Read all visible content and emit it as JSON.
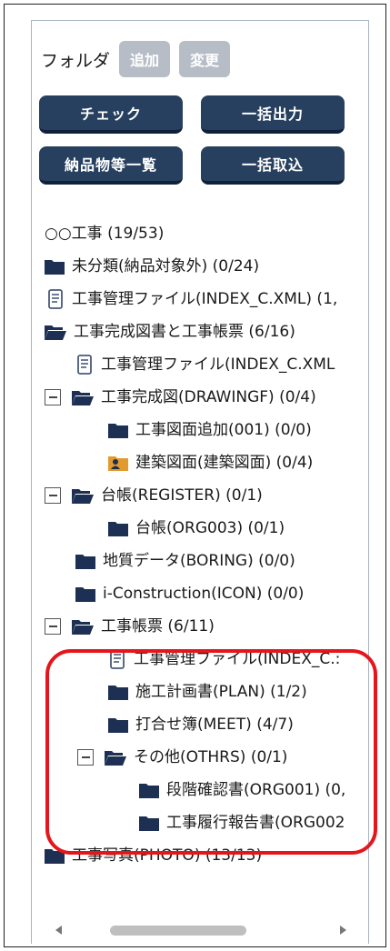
{
  "toolbar": {
    "folder_label": "フォルダ",
    "add_label": "追加",
    "change_label": "変更",
    "check_label": "チェック",
    "bulk_output_label": "一括出力",
    "deliverables_list_label": "納品物等一覧",
    "bulk_import_label": "一括取込"
  },
  "tree": {
    "root": "○○工事 (19/53)",
    "unclassified": "未分類(納品対象外) (0/24)",
    "mgmt_file_1": "工事管理ファイル(INDEX_C.XML) (1,",
    "completion_docs": "工事完成図書と工事帳票 (6/16)",
    "mgmt_file_2": "工事管理ファイル(INDEX_C.XML",
    "drawingf": "工事完成図(DRAWINGF) (0/4)",
    "drawing_add": "工事図面追加(001) (0/0)",
    "building_drawing": "建築図面(建築図面) (0/4)",
    "register": "台帳(REGISTER) (0/1)",
    "register_org": "台帳(ORG003) (0/1)",
    "boring": "地質データ(BORING) (0/0)",
    "icon": "i-Construction(ICON) (0/0)",
    "meet_docs": "工事帳票 (6/11)",
    "mgmt_file_3": "工事管理ファイル(INDEX_C.:",
    "plan": "施工計画書(PLAN) (1/2)",
    "meet": "打合せ簿(MEET) (4/7)",
    "othrs": "その他(OTHRS) (0/1)",
    "org001": "段階確認書(ORG001) (0,",
    "org002": "工事履行報告書(ORG002",
    "photo": "工事写真(PHOTO) (13/13)"
  },
  "colors": {
    "button_bg": "#27405f",
    "button_disabled": "#b7bdc7",
    "folder_icon": "#1d2f52",
    "highlight": "#e5161b"
  }
}
